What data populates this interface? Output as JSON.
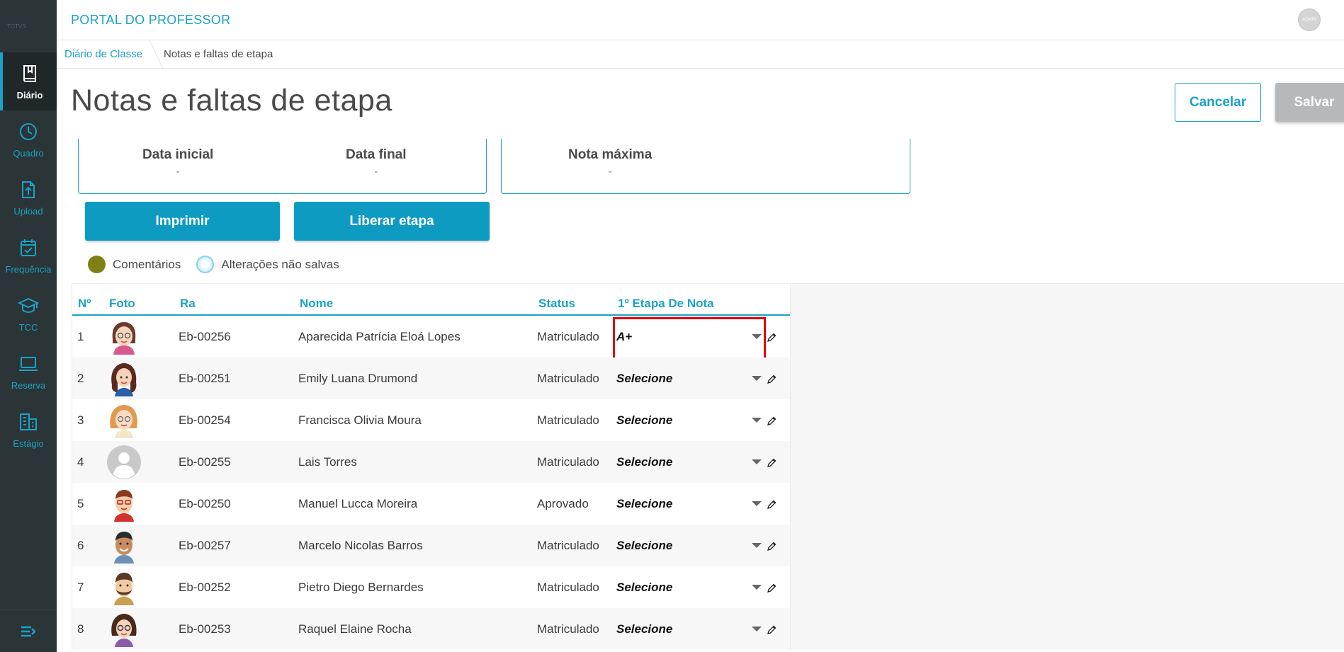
{
  "header": {
    "app_title": "PORTAL DO PROFESSOR",
    "user_initials": "ADMIN"
  },
  "sidebar": {
    "logo_text": "TOTVS",
    "items": [
      {
        "label": "Diário",
        "icon": "book-icon",
        "active": true
      },
      {
        "label": "Quadro",
        "icon": "clock-icon",
        "active": false
      },
      {
        "label": "Upload",
        "icon": "file-upload-icon",
        "active": false
      },
      {
        "label": "Frequência",
        "icon": "calendar-check-icon",
        "active": false
      },
      {
        "label": "TCC",
        "icon": "graduation-cap-icon",
        "active": false
      },
      {
        "label": "Reserva",
        "icon": "laptop-icon",
        "active": false
      },
      {
        "label": "Estágio",
        "icon": "building-icon",
        "active": false
      }
    ]
  },
  "breadcrumb": {
    "link": "Diário de Classe",
    "current": "Notas e faltas de etapa"
  },
  "page": {
    "title": "Notas e faltas de etapa",
    "cancel_label": "Cancelar",
    "save_label": "Salvar",
    "print_label": "Imprimir",
    "release_label": "Liberar etapa"
  },
  "info": {
    "start_date_label": "Data inicial",
    "start_date_value": "-",
    "end_date_label": "Data final",
    "end_date_value": "-",
    "max_grade_label": "Nota máxima",
    "max_grade_value": "-"
  },
  "legend": {
    "comments": "Comentários",
    "unsaved": "Alterações não salvas"
  },
  "colors": {
    "accent": "#1aa3c6",
    "primary_button": "#0e9bc2",
    "sidebar": "#2b3436",
    "comments_dot": "#7f7f14",
    "highlight": "#e3000f"
  },
  "table": {
    "columns": [
      "Nº",
      "Foto",
      "Ra",
      "Nome",
      "Status",
      "1º Etapa De Nota"
    ],
    "rows": [
      {
        "n": "1",
        "ra": "Eb-00256",
        "name": "Aparecida Patrícia Eloá Lopes",
        "status": "Matriculado",
        "grade": "A+"
      },
      {
        "n": "2",
        "ra": "Eb-00251",
        "name": "Emily Luana Drumond",
        "status": "Matriculado",
        "grade": "Selecione"
      },
      {
        "n": "3",
        "ra": "Eb-00254",
        "name": "Francisca Olivia Moura",
        "status": "Matriculado",
        "grade": "Selecione"
      },
      {
        "n": "4",
        "ra": "Eb-00255",
        "name": "Lais Torres",
        "status": "Matriculado",
        "grade": "Selecione"
      },
      {
        "n": "5",
        "ra": "Eb-00250",
        "name": "Manuel Lucca Moreira",
        "status": "Aprovado",
        "grade": "Selecione"
      },
      {
        "n": "6",
        "ra": "Eb-00257",
        "name": "Marcelo Nicolas Barros",
        "status": "Matriculado",
        "grade": "Selecione"
      },
      {
        "n": "7",
        "ra": "Eb-00252",
        "name": "Pietro Diego Bernardes",
        "status": "Matriculado",
        "grade": "Selecione"
      },
      {
        "n": "8",
        "ra": "Eb-00253",
        "name": "Raquel Elaine Rocha",
        "status": "Matriculado",
        "grade": "Selecione"
      }
    ]
  }
}
